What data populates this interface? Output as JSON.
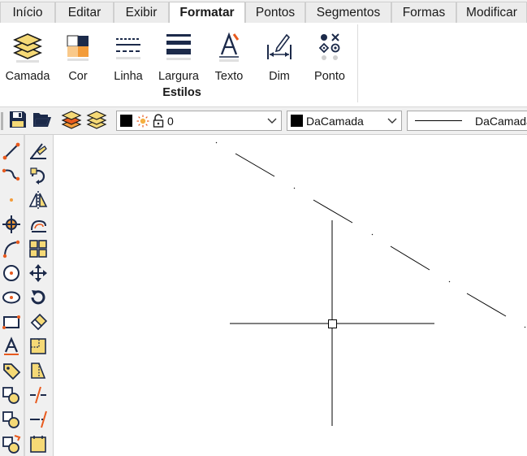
{
  "menu_tabs": [
    "Início",
    "Editar",
    "Exibir",
    "Formatar",
    "Pontos",
    "Segmentos",
    "Formas",
    "Modificar"
  ],
  "active_tab": "Formatar",
  "ribbon": {
    "buttons": [
      "Camada",
      "Cor",
      "Linha",
      "Largura",
      "Texto",
      "Dim",
      "Ponto"
    ],
    "group_label": "Estilos"
  },
  "properties": {
    "layer_value": "0",
    "color_value": "DaCamada",
    "linetype_value": "DaCamada"
  },
  "colors": {
    "accent_orange": "#e85a1e",
    "layer_yellow": "#f5d976",
    "navy": "#1c2a4a"
  },
  "left_tools": {
    "col1": [
      "line-icon",
      "polyline-icon",
      "point-icon",
      "center-snap-icon",
      "arc-icon",
      "circle-icon",
      "ellipse-icon",
      "rectangle-icon",
      "text-icon",
      "tag-icon",
      "block-icon",
      "block-insert-icon",
      "block-edit-icon"
    ],
    "col2": [
      "trim-icon",
      "rotate-copy-icon",
      "mirror-icon",
      "offset-icon",
      "array-icon",
      "move-icon",
      "rotate-icon",
      "erase-icon",
      "scale-icon",
      "stretch-icon",
      "break-icon",
      "extend-icon",
      "page-icon"
    ]
  }
}
